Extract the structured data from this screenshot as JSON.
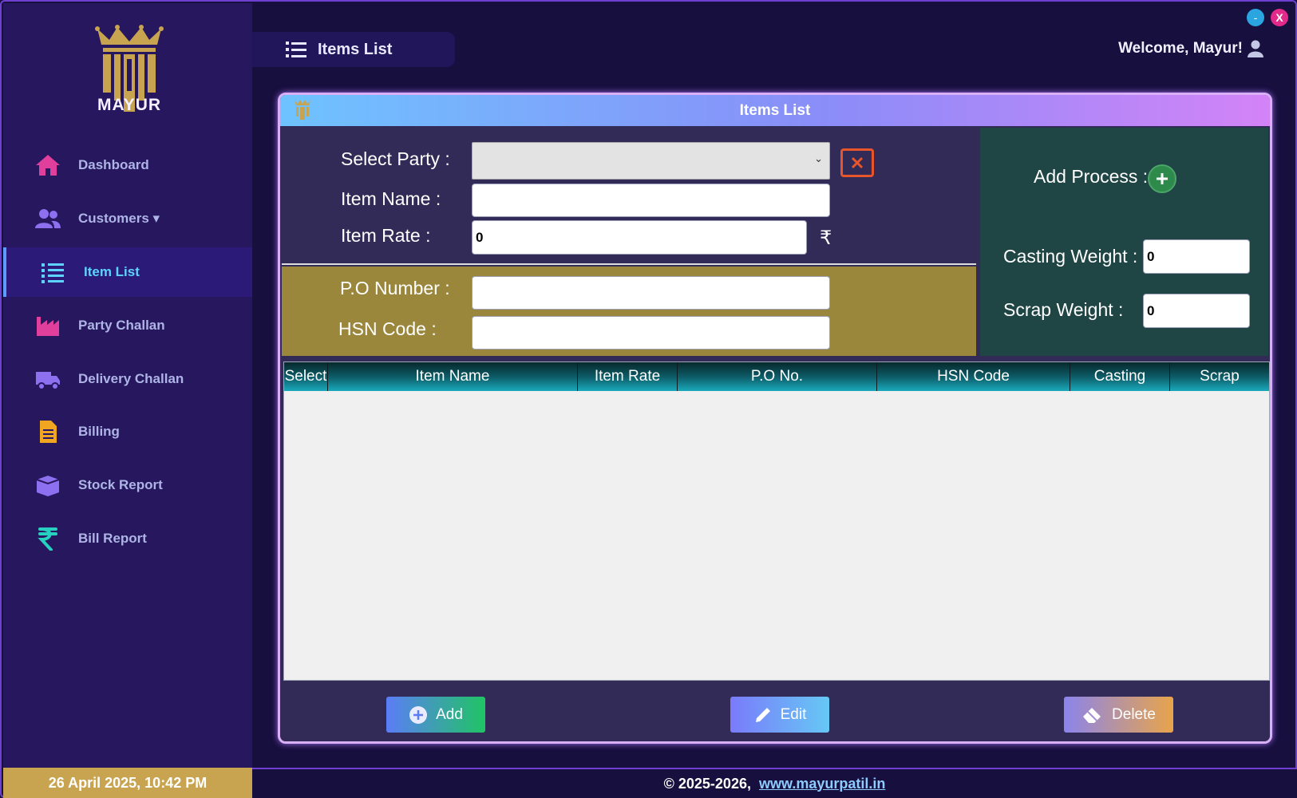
{
  "window": {
    "minimize_label": "-",
    "close_label": "X"
  },
  "brand": {
    "name": "MAYUR"
  },
  "sidebar": {
    "items": [
      {
        "label": "Dashboard",
        "icon": "home-icon",
        "color": "#e0409c"
      },
      {
        "label": "Customers ▾",
        "icon": "users-icon",
        "color": "#8d70f0"
      },
      {
        "label": "Item List",
        "icon": "list-icon",
        "color": "#5fd3ff",
        "active": true
      },
      {
        "label": "Party Challan",
        "icon": "factory-icon",
        "color": "#e0409c"
      },
      {
        "label": "Delivery Challan",
        "icon": "truck-icon",
        "color": "#8d70f0"
      },
      {
        "label": "Billing",
        "icon": "invoice-icon",
        "color": "#f0a620"
      },
      {
        "label": "Stock Report",
        "icon": "box-icon",
        "color": "#8d70f0"
      },
      {
        "label": "Bill Report",
        "icon": "rupee-icon",
        "color": "#28d0c0"
      }
    ]
  },
  "header": {
    "page_title": "Items List",
    "welcome": "Welcome, Mayur!"
  },
  "panel": {
    "title": "Items List",
    "form": {
      "select_party_label": "Select Party :",
      "select_party_value": "",
      "item_name_label": "Item Name :",
      "item_name_value": "",
      "item_rate_label": "Item Rate :",
      "item_rate_value": "0",
      "currency_symbol": "₹",
      "po_number_label": "P.O Number :",
      "po_number_value": "",
      "hsn_code_label": "HSN Code :",
      "hsn_code_value": "",
      "add_process_label": "Add Process :",
      "casting_weight_label": "Casting Weight :",
      "casting_weight_value": "0",
      "scrap_weight_label": "Scrap Weight :",
      "scrap_weight_value": "0"
    },
    "table": {
      "columns": [
        "Select",
        "Item Name",
        "Item Rate",
        "P.O No.",
        "HSN Code",
        "Casting",
        "Scrap"
      ],
      "rows": []
    },
    "actions": {
      "add_label": "Add",
      "edit_label": "Edit",
      "delete_label": "Delete"
    }
  },
  "statusbar": {
    "datetime": "26 April 2025, 10:42 PM",
    "copyright": "© 2025-2026,",
    "website": "www.mayurpatil.in"
  },
  "colors": {
    "sidebar_bg": "#26175f",
    "app_bg": "#170f3e",
    "gold": "#c8a451",
    "accent": "#5fd3ff"
  }
}
